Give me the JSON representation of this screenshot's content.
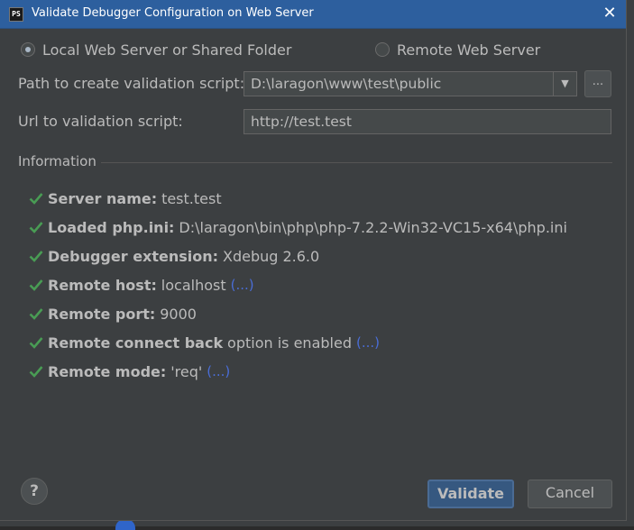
{
  "window": {
    "title": "Validate Debugger Configuration on Web Server",
    "app_icon_text": "PS"
  },
  "radios": {
    "local": {
      "label": "Local Web Server or Shared Folder",
      "checked": true
    },
    "remote": {
      "label": "Remote Web Server",
      "checked": false
    }
  },
  "form": {
    "path_label": "Path to create validation script:",
    "path_value": "D:\\laragon\\www\\test\\public",
    "browse_label": "...",
    "url_label": "Url to validation script:",
    "url_value": "http://test.test"
  },
  "information": {
    "title": "Information",
    "items": [
      {
        "key": "Server name:",
        "value": "test.test",
        "link": ""
      },
      {
        "key": "Loaded php.ini:",
        "value": "D:\\laragon\\bin\\php\\php-7.2.2-Win32-VC15-x64\\php.ini",
        "link": ""
      },
      {
        "key": "Debugger extension:",
        "value": "Xdebug 2.6.0",
        "link": ""
      },
      {
        "key": "Remote host:",
        "value": "localhost",
        "link": "(...)"
      },
      {
        "key": "Remote port:",
        "value": "9000",
        "link": ""
      },
      {
        "key": "Remote connect back",
        "value": "option is enabled",
        "link": "(...)"
      },
      {
        "key": "Remote mode:",
        "value": "'req'",
        "link": "(...)"
      }
    ]
  },
  "buttons": {
    "help": "?",
    "validate": "Validate",
    "cancel": "Cancel"
  },
  "colors": {
    "titlebar": "#2d5f9e",
    "dialog_bg": "#3c3f41",
    "check_green": "#499c54",
    "link_blue": "#4a6dd6"
  }
}
